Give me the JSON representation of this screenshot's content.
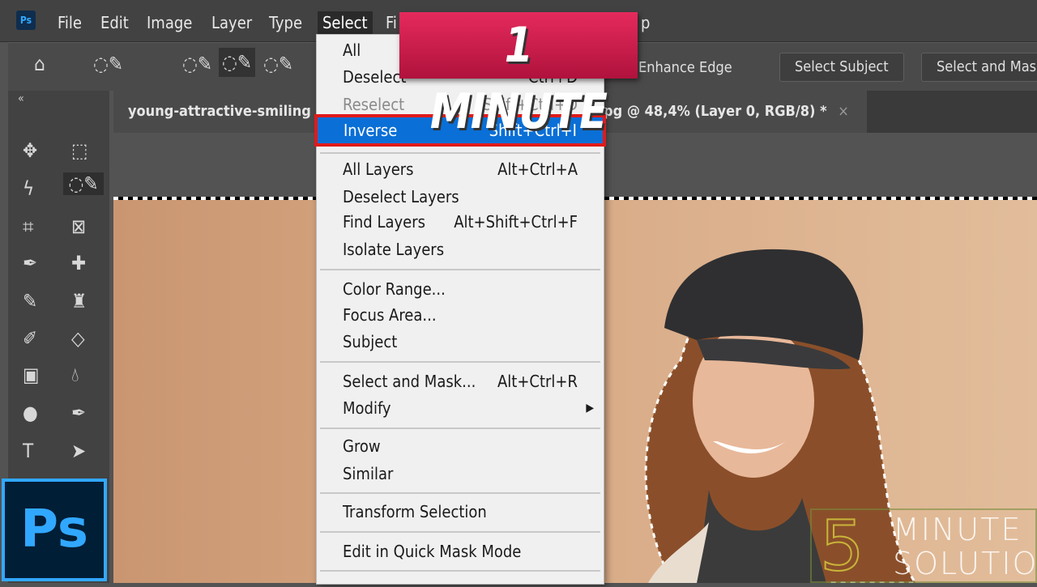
{
  "menubar": {
    "items": [
      "File",
      "Edit",
      "Image",
      "Layer",
      "Type",
      "Select",
      "Fi",
      "p"
    ],
    "active": "Select",
    "logo": "Ps"
  },
  "options": {
    "enhance_edge": "Enhance Edge",
    "select_subject": "Select Subject",
    "select_and_mask": "Select and Mas"
  },
  "tabs": {
    "left": "young-attractive-smiling",
    "right": "pg @ 48,4% (Layer 0, RGB/8) *",
    "close": "×"
  },
  "panel_collapse": "«",
  "menu": {
    "items": [
      {
        "label": "All",
        "shortcut": ""
      },
      {
        "label": "Deselect",
        "shortcut": "Ctrl+D"
      },
      {
        "label": "Reselect",
        "shortcut": "Shift+Ctrl+D",
        "disabled": true
      },
      {
        "label": "Inverse",
        "shortcut": "Shift+Ctrl+I",
        "highlighted": true
      },
      {
        "label": "All Layers",
        "shortcut": "Alt+Ctrl+A"
      },
      {
        "label": "Deselect Layers",
        "shortcut": ""
      },
      {
        "label": "Find Layers",
        "shortcut": "Alt+Shift+Ctrl+F"
      },
      {
        "label": "Isolate Layers",
        "shortcut": ""
      },
      {
        "label": "Color Range...",
        "shortcut": ""
      },
      {
        "label": "Focus Area...",
        "shortcut": ""
      },
      {
        "label": "Subject",
        "shortcut": ""
      },
      {
        "label": "Select and Mask...",
        "shortcut": "Alt+Ctrl+R"
      },
      {
        "label": "Modify",
        "shortcut": "▶"
      },
      {
        "label": "Grow",
        "shortcut": ""
      },
      {
        "label": "Similar",
        "shortcut": ""
      },
      {
        "label": "Transform Selection",
        "shortcut": ""
      },
      {
        "label": "Edit in Quick Mask Mode",
        "shortcut": ""
      }
    ]
  },
  "overlay": {
    "banner": "1 MINUTE",
    "logo": "Ps",
    "watermark_number": "5",
    "watermark_line1": "MINUTE",
    "watermark_line2": "SOLUTION"
  },
  "colors": {
    "highlight": "#0a6fd6",
    "banner": "#d81e4f",
    "ps_blue": "#31a8ff",
    "outline": "#e01a1a"
  }
}
